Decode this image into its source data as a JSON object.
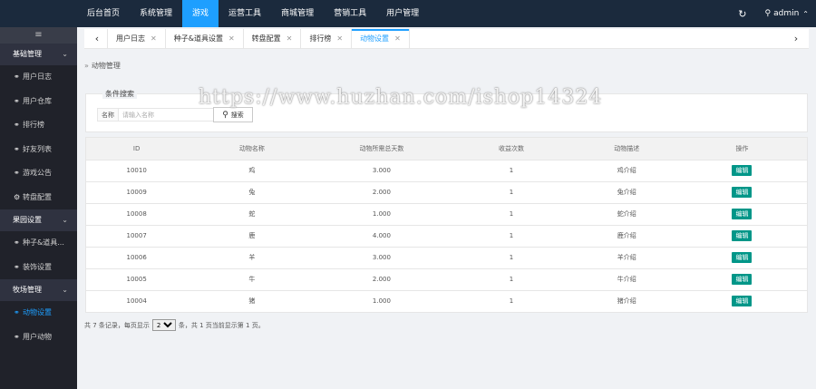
{
  "topnav": {
    "items": [
      "后台首页",
      "系统管理",
      "游戏",
      "运营工具",
      "商城管理",
      "营销工具",
      "用户管理"
    ],
    "active_index": 2,
    "refresh_icon": "refresh-icon",
    "user": "admin"
  },
  "sidebar": {
    "toggle": "≡",
    "groups": [
      {
        "label": "基础管理",
        "items": [
          "用户日志",
          "用户仓库",
          "排行榜",
          "好友列表",
          "游戏公告",
          "转盘配置"
        ]
      },
      {
        "label": "果园设置",
        "items": [
          "种子&道具...",
          "装饰设置"
        ]
      },
      {
        "label": "牧场管理",
        "items": [
          "动物设置",
          "用户动物"
        ]
      }
    ],
    "active_item": "动物设置"
  },
  "tabs": {
    "items": [
      "用户日志",
      "种子&道具设置",
      "转盘配置",
      "排行榜",
      "动物设置"
    ],
    "active_index": 4
  },
  "breadcrumb": {
    "text": "动物管理"
  },
  "filter": {
    "title": "条件搜索",
    "label": "名称",
    "placeholder": "请输入名称",
    "button": "搜索"
  },
  "table": {
    "headers": [
      "ID",
      "动物名称",
      "动物所需总天数",
      "收益次数",
      "动物描述",
      "操作"
    ],
    "rows": [
      {
        "id": "10010",
        "name": "鸡",
        "days": "3.000",
        "count": "1",
        "desc": "鸡介绍",
        "op": "编辑"
      },
      {
        "id": "10009",
        "name": "兔",
        "days": "2.000",
        "count": "1",
        "desc": "兔介绍",
        "op": "编辑"
      },
      {
        "id": "10008",
        "name": "蛇",
        "days": "1.000",
        "count": "1",
        "desc": "蛇介绍",
        "op": "编辑"
      },
      {
        "id": "10007",
        "name": "鹿",
        "days": "4.000",
        "count": "1",
        "desc": "鹿介绍",
        "op": "编辑"
      },
      {
        "id": "10006",
        "name": "羊",
        "days": "3.000",
        "count": "1",
        "desc": "羊介绍",
        "op": "编辑"
      },
      {
        "id": "10005",
        "name": "牛",
        "days": "2.000",
        "count": "1",
        "desc": "牛介绍",
        "op": "编辑"
      },
      {
        "id": "10004",
        "name": "猪",
        "days": "1.000",
        "count": "1",
        "desc": "猪介绍",
        "op": "编辑"
      }
    ]
  },
  "pager": {
    "prefix": "共 7 条记录，每页显示",
    "page_size": "20",
    "suffix": "条，共 1 页当前显示第 1 页。"
  },
  "watermark": "https://www.huzhan.com/ishop14324",
  "colors": {
    "topbar": "#1b2a3d",
    "accent": "#1e9fff",
    "sidebar": "#20222a",
    "op_button": "#009688"
  }
}
